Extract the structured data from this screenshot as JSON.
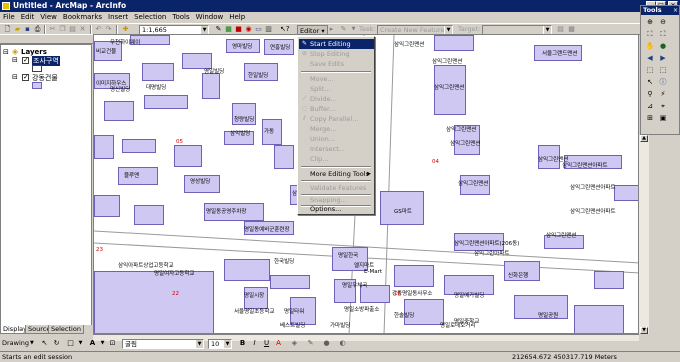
{
  "window": {
    "title": "Untitled - ArcMap - ArcInfo"
  },
  "menu": [
    "File",
    "Edit",
    "View",
    "Bookmarks",
    "Insert",
    "Selection",
    "Tools",
    "Window",
    "Help"
  ],
  "toolbar": {
    "scale": "1:1,665",
    "editor_label": "Editor",
    "task_label": "Task:",
    "task_value": "Create New Feature",
    "target_label": "Target:"
  },
  "toc": {
    "root": "Layers",
    "layers": [
      "조사구역",
      "강동건물"
    ],
    "tabs": [
      "Display",
      "Source",
      "Selection"
    ]
  },
  "editor_menu": [
    {
      "label": "Start Editing",
      "state": "selected"
    },
    {
      "label": "Stop Editing",
      "state": "disabled"
    },
    {
      "label": "Save Edits",
      "state": "disabled"
    },
    {
      "label": "---"
    },
    {
      "label": "Move...",
      "state": "disabled"
    },
    {
      "label": "Split...",
      "state": "disabled"
    },
    {
      "label": "Divide...",
      "state": "disabled"
    },
    {
      "label": "Buffer...",
      "state": "disabled"
    },
    {
      "label": "Copy Parallel...",
      "state": "disabled"
    },
    {
      "label": "Merge...",
      "state": "disabled"
    },
    {
      "label": "Union...",
      "state": "disabled"
    },
    {
      "label": "Intersect...",
      "state": "disabled"
    },
    {
      "label": "Clip...",
      "state": "disabled"
    },
    {
      "label": "---"
    },
    {
      "label": "More Editing Tools",
      "state": "enabled"
    },
    {
      "label": "---"
    },
    {
      "label": "Validate Features",
      "state": "disabled"
    },
    {
      "label": "---"
    },
    {
      "label": "Snapping...",
      "state": "disabled"
    },
    {
      "label": "---"
    },
    {
      "label": "Options...",
      "state": "enabled"
    }
  ],
  "tools_panel": {
    "title": "Tools"
  },
  "map": {
    "labels": [
      "우천하이웨이",
      "영마빌딩",
      "연흥빌딩",
      "비교건물",
      "이미지하우스",
      "삼익그린맨션",
      "서울그랜드맨션",
      "삼익그린맨션",
      "삼익그린맨션",
      "삼익그린맨션",
      "삼익그린맨션",
      "삼익그린맨션",
      "삼익그린맨션아파트",
      "삼익그린맨션아파트",
      "삼익그린맨션아파트",
      "삼익그린맨션",
      "삼익그린맨션",
      "삼익그린맨션아파트(206동)",
      "삼익그린아파트",
      "명신빌딩",
      "대명빌딩",
      "영일빌딩",
      "한일빌딩",
      "청량빌딩",
      "삼익빌딩",
      "가동",
      "블루맨",
      "영성빌딩",
      "GS마트",
      "명일동공영주차장",
      "명일동예비군훈련장",
      "삼익아파트",
      "명일여자고등학교",
      "삼익아파트상업고등학교",
      "서울명일초등학교",
      "한국빌딩",
      "명일시장",
      "신화은행",
      "E-Mart",
      "명일한국",
      "명일우체국",
      "명일소방파출소",
      "강동명일동사무소",
      "엘지마트",
      "한솔빌딩",
      "명일중학교",
      "가마빌딩",
      "베스트빌딩",
      "명일로데오거리",
      "명일공원",
      "명일예가빌딩",
      "명일타워"
    ],
    "red_labels": [
      "05",
      "04",
      "22",
      "23",
      "16"
    ]
  },
  "drawing_toolbar": {
    "label": "Drawing",
    "font": "굴림",
    "size": "10"
  },
  "status": {
    "message": "Starts an edit session",
    "coords": "212654.672  450317.719 Meters"
  }
}
